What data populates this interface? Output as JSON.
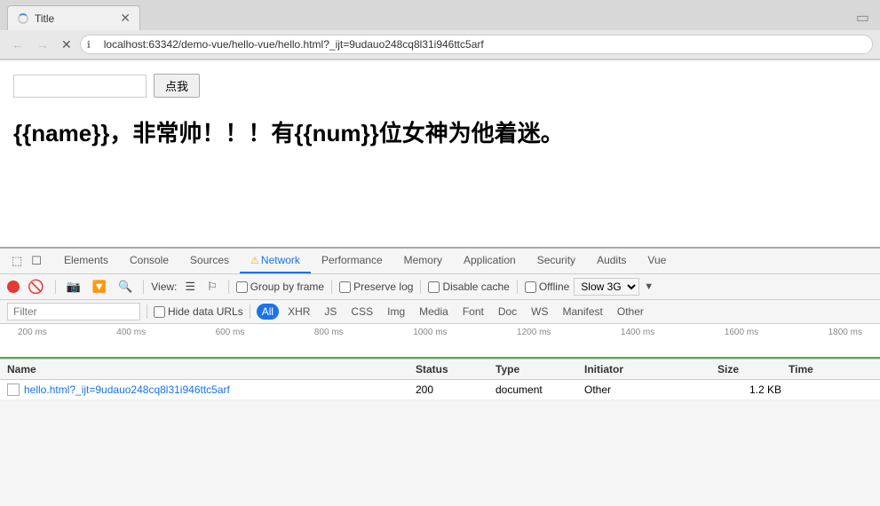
{
  "browser": {
    "tab": {
      "title": "Title",
      "favicon": "spinner"
    },
    "address": "localhost:63342/demo-vue/hello-vue/hello.html?_ijt=9udauo248cq8l31i946ttc5arf",
    "nav": {
      "back": "←",
      "forward": "→",
      "refresh": "✕"
    }
  },
  "page": {
    "input_placeholder": "",
    "button_label": "点我",
    "main_text": "{{name}}，非常帅！！！有{{num}}位女神为他着迷。"
  },
  "devtools": {
    "tabs": [
      {
        "id": "elements",
        "label": "Elements",
        "active": false
      },
      {
        "id": "console",
        "label": "Console",
        "active": false
      },
      {
        "id": "sources",
        "label": "Sources",
        "active": false
      },
      {
        "id": "network",
        "label": "Network",
        "active": true,
        "warning": true
      },
      {
        "id": "performance",
        "label": "Performance",
        "active": false
      },
      {
        "id": "memory",
        "label": "Memory",
        "active": false
      },
      {
        "id": "application",
        "label": "Application",
        "active": false
      },
      {
        "id": "security",
        "label": "Security",
        "active": false
      },
      {
        "id": "audits",
        "label": "Audits",
        "active": false
      },
      {
        "id": "vue",
        "label": "Vue",
        "active": false
      }
    ],
    "toolbar": {
      "view_label": "View:",
      "group_by_frame": "Group by frame",
      "preserve_log": "Preserve log",
      "disable_cache": "Disable cache",
      "offline": "Offline",
      "throttle": "Slow 3G"
    },
    "filter_bar": {
      "placeholder": "Filter",
      "hide_data_urls": "Hide data URLs",
      "tags": [
        "All",
        "XHR",
        "JS",
        "CSS",
        "Img",
        "Media",
        "Font",
        "Doc",
        "WS",
        "Manifest",
        "Other"
      ]
    },
    "timeline": {
      "labels": [
        "200 ms",
        "400 ms",
        "600 ms",
        "800 ms",
        "1000 ms",
        "1200 ms",
        "1400 ms",
        "1600 ms",
        "1800 ms"
      ]
    },
    "table": {
      "headers": [
        "Name",
        "Status",
        "Type",
        "Initiator",
        "Size",
        "Time"
      ],
      "rows": [
        {
          "name": "hello.html?_ijt=9udauo248cq8l31i946ttc5arf",
          "status": "200",
          "type": "document",
          "initiator": "Other",
          "size": "1.2 KB",
          "time": ""
        }
      ]
    }
  }
}
